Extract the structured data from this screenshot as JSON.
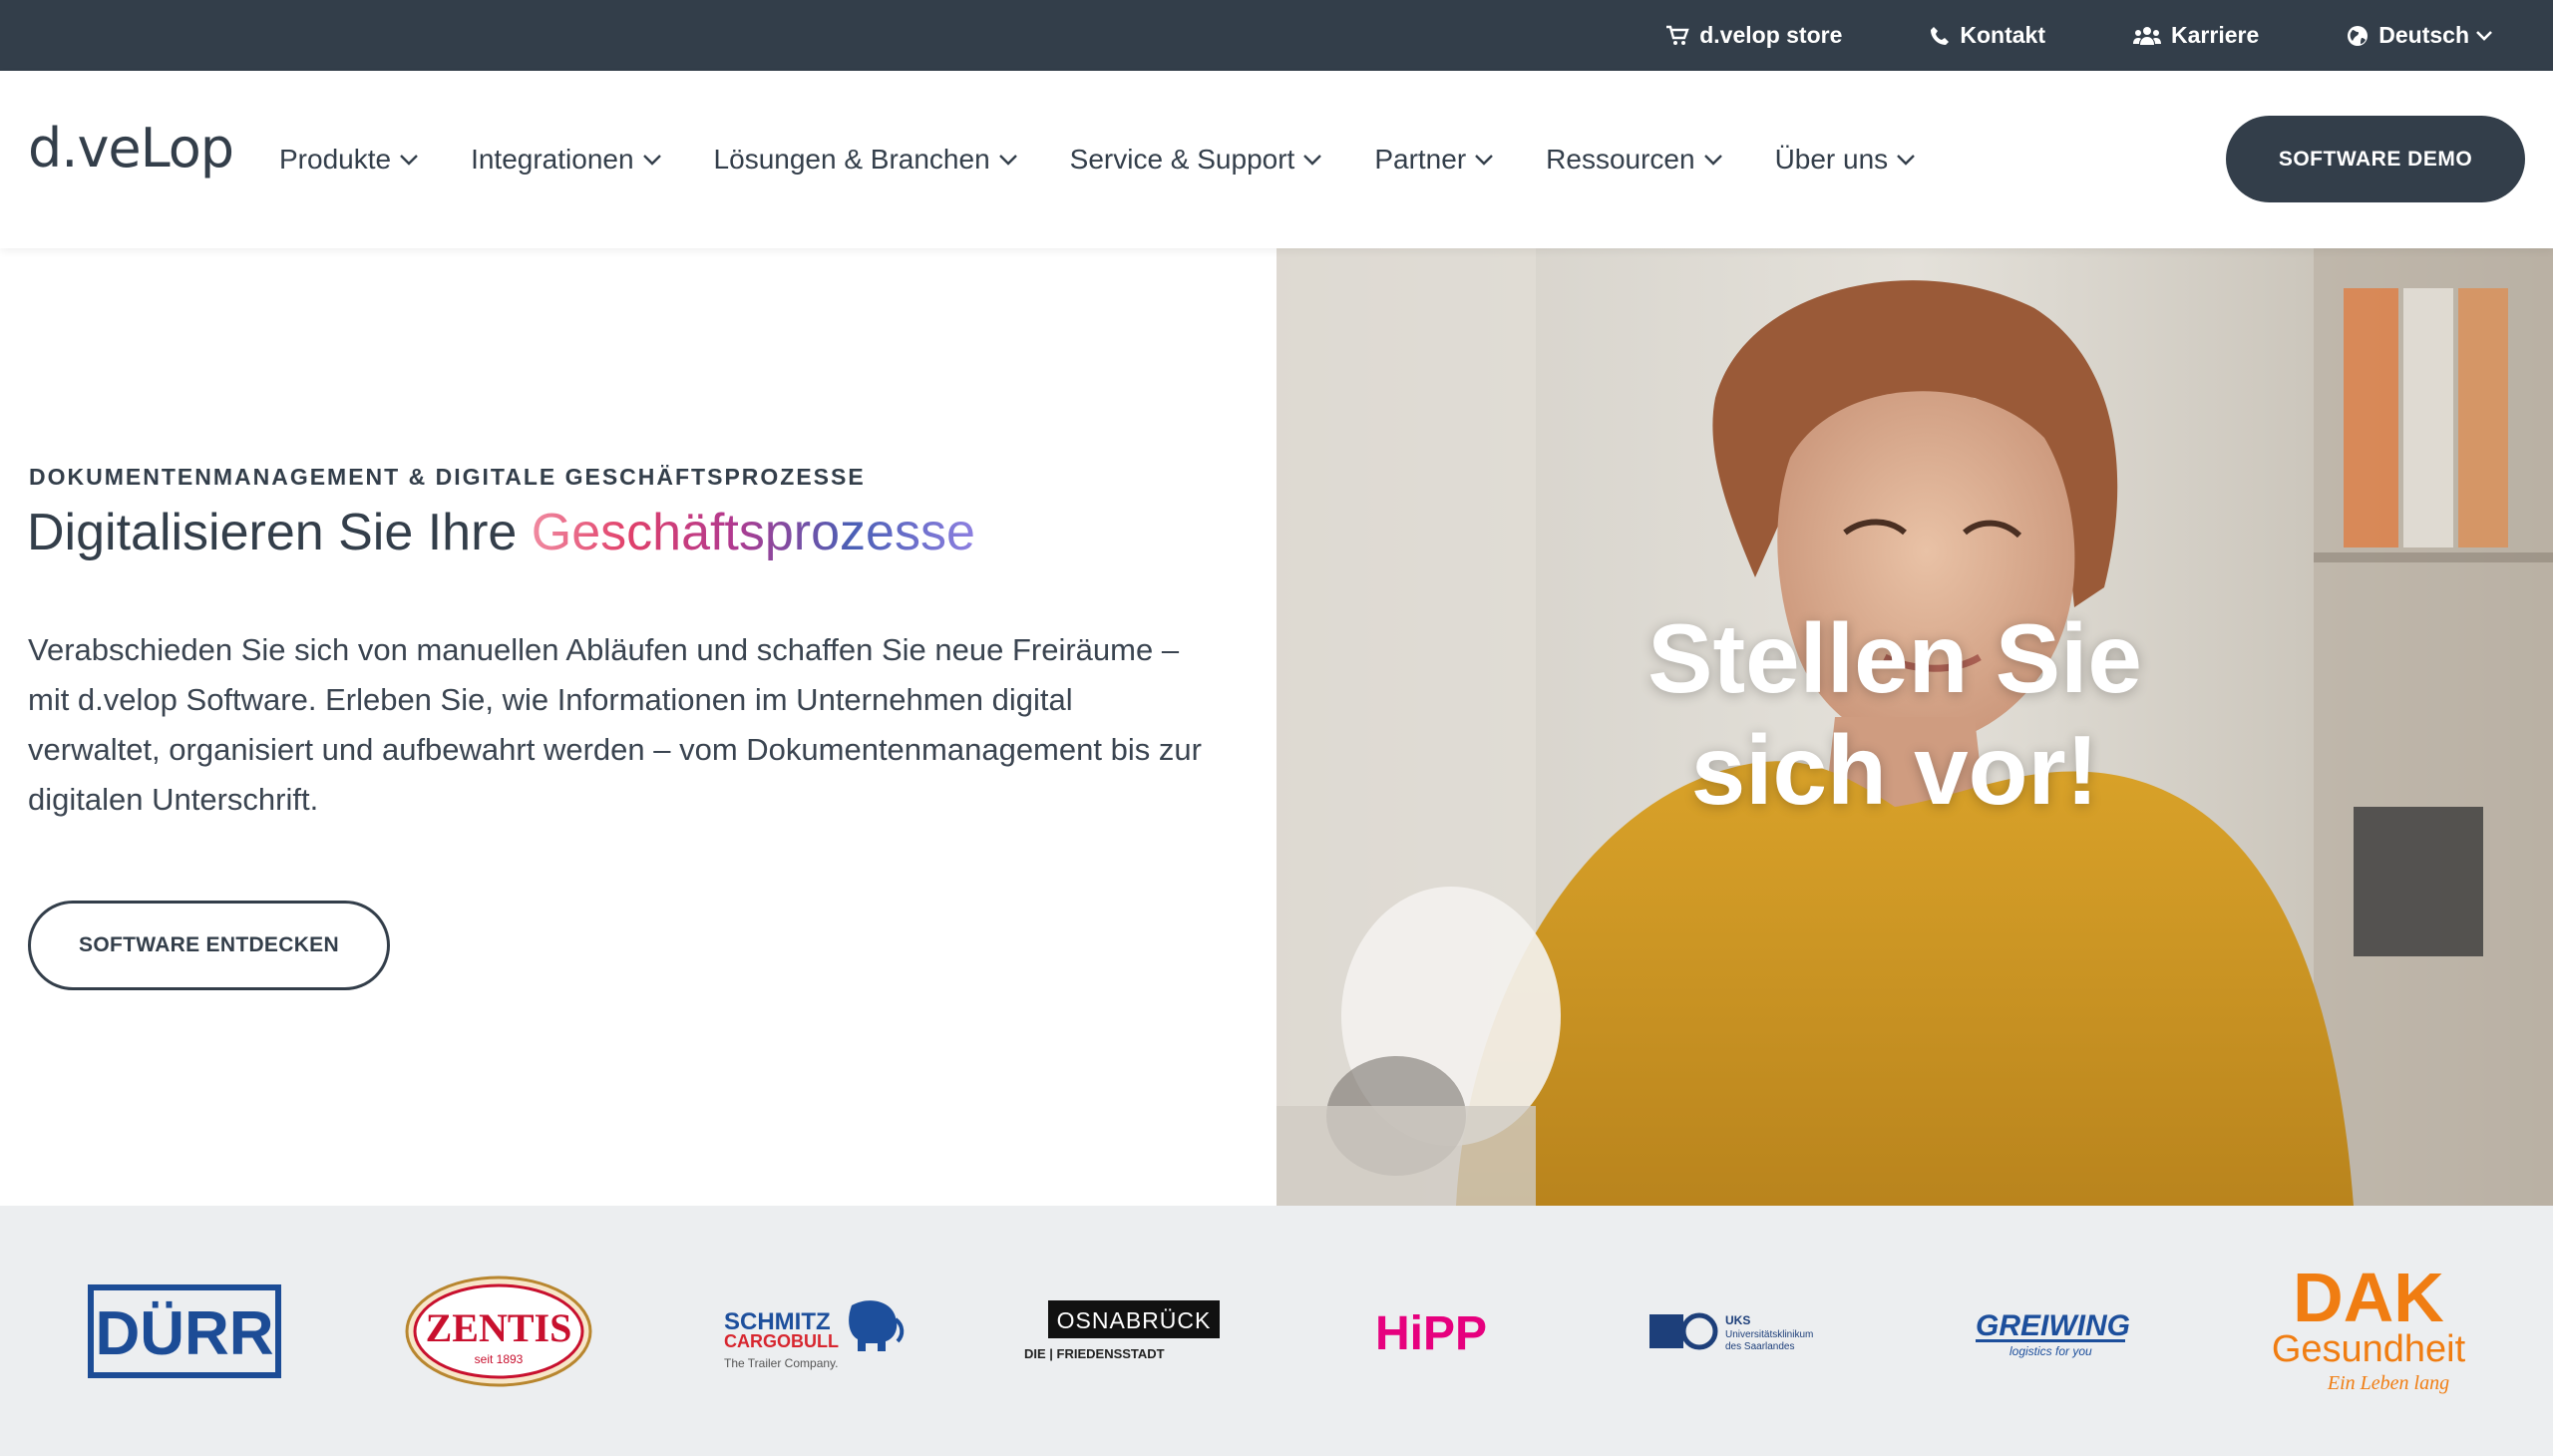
{
  "topbar": {
    "store": "d.velop store",
    "contact": "Kontakt",
    "career": "Karriere",
    "language": "Deutsch"
  },
  "header": {
    "logo": "d.veLop",
    "nav": [
      {
        "label": "Produkte"
      },
      {
        "label": "Integrationen"
      },
      {
        "label": "Lösungen & Branchen"
      },
      {
        "label": "Service & Support"
      },
      {
        "label": "Partner"
      },
      {
        "label": "Ressourcen"
      },
      {
        "label": "Über uns"
      }
    ],
    "demo_button": "SOFTWARE DEMO"
  },
  "hero": {
    "eyebrow": "DOKUMENTENMANAGEMENT & DIGITALE GESCHÄFTSPROZESSE",
    "headline_plain": "Digitalisieren Sie Ihre ",
    "headline_gradient": "Geschäftsprozesse",
    "lead": "Verabschieden Sie sich von manuellen Abläufen und schaffen Sie neue Freiräume – mit d.velop Software. Erleben Sie, wie Informationen im Unternehmen digital verwaltet, organisiert und aufbewahrt werden – vom Dokumentenmanagement bis zur digitalen Unterschrift.",
    "cta": "SOFTWARE ENTDECKEN",
    "video_overlay_line1": "Stellen Sie",
    "video_overlay_line2": "sich vor!"
  },
  "logos": {
    "durr": "DÜRR",
    "zentis": "ZENTIS",
    "zentis_sub": "seit 1893",
    "schmitz_line1": "SCHMITZ",
    "schmitz_line2": "CARGOBULL",
    "schmitz_tag": "The Trailer Company.",
    "osnabrueck": "OSNABRÜCK",
    "osnabrueck_sub": "DIE | FRIEDENSSTADT",
    "hipp": "HiPP",
    "uks": "UKS",
    "uks_sub1": "Universitätsklinikum",
    "uks_sub2": "des Saarlandes",
    "greiwing": "GREIWING",
    "greiwing_sub": "logistics for you",
    "dak": "DAK",
    "dak_sub": "Gesundheit",
    "dak_tag": "Ein Leben lang"
  },
  "colors": {
    "dark": "#333e4a",
    "logo_strip_bg": "#eceef0",
    "durr_blue": "#1c4c96",
    "dak_orange": "#f07d12"
  }
}
